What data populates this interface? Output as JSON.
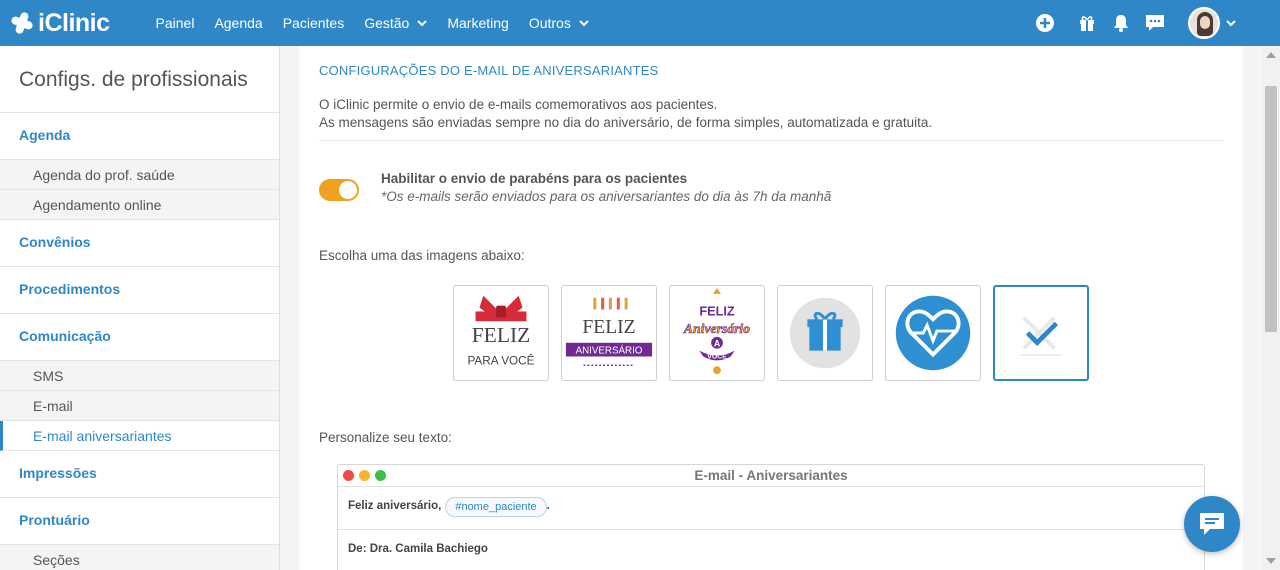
{
  "brand": {
    "name": "iClinic",
    "accent": "#2f87c8",
    "toggle_color": "#f0a11f"
  },
  "nav": {
    "items": [
      {
        "label": "Painel"
      },
      {
        "label": "Agenda"
      },
      {
        "label": "Pacientes"
      },
      {
        "label": "Gestão",
        "has_dropdown": true
      },
      {
        "label": "Marketing"
      },
      {
        "label": "Outros",
        "has_dropdown": true
      }
    ],
    "icons": [
      "plus-circle-icon",
      "gift-icon",
      "bell-icon",
      "chat-icon"
    ]
  },
  "sidebar": {
    "title": "Configs. de profissionais",
    "sections": [
      {
        "label": "Agenda",
        "items": [
          "Agenda do prof. saúde",
          "Agendamento online"
        ]
      },
      {
        "label": "Convênios"
      },
      {
        "label": "Procedimentos"
      },
      {
        "label": "Comunicação",
        "items": [
          "SMS",
          "E-mail",
          "E-mail aniversariantes"
        ]
      },
      {
        "label": "Impressões"
      },
      {
        "label": "Prontuário",
        "items": [
          "Seções"
        ]
      }
    ],
    "active_item": "E-mail aniversariantes"
  },
  "main": {
    "section_title": "CONFIGURAÇÕES DO E-MAIL DE ANIVERSARIANTES",
    "description_line1": "O iClinic permite o envio de e-mails comemorativos aos pacientes.",
    "description_line2": "As mensagens são enviadas sempre no dia do aniversário, de forma simples, automatizada e gratuita.",
    "toggle": {
      "enabled": true,
      "label": "Habilitar o envio de parabéns para os pacientes",
      "note": "*Os e-mails serão enviados para os aniversariantes do dia às 7h da manhã"
    },
    "choose_label": "Escolha uma das imagens abaixo:",
    "images": {
      "img1_line1": "FELIZ",
      "img1_line2": "PARA VOCÊ",
      "img2_line1": "FELIZ",
      "img2_line2": "ANIVERSÁRIO",
      "img3_line1": "FELIZ",
      "img3_line2": "Aniversário",
      "img3_line3": "A",
      "img3_line4": "VOCÊ",
      "selected_index": 5
    },
    "personalize_label": "Personalize seu texto:",
    "editor": {
      "window_title": "E-mail - Aniversariantes",
      "greeting": "Feliz aniversário,",
      "placeholder_tag": "#nome_paciente",
      "greeting_end": ".",
      "from_line": "De: Dra. Camila Bachiego"
    }
  }
}
